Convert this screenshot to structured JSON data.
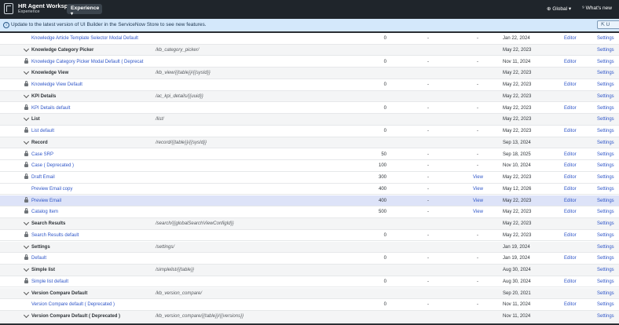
{
  "header": {
    "app_title": "HR Agent Workspace",
    "app_subtitle": "Experience",
    "experience_btn": "Experience",
    "global_label": "Global",
    "whats_new": "What's new"
  },
  "banner": {
    "message": "Update to the latest version of UI Builder in the ServiceNow Store to see new features.",
    "button": "U"
  },
  "rows": [
    {
      "type": "item",
      "locked": false,
      "name": "Knowledge Article Template Selector Modal Default",
      "path": "",
      "order": "0",
      "d1": "-",
      "d2": "-",
      "date": "Jan 22, 2024",
      "editor": "Editor",
      "settings": "Settings"
    },
    {
      "type": "group",
      "name": "Knowledge Category Picker",
      "path": "/kb_category_picker/",
      "order": "",
      "d1": "",
      "d2": "",
      "date": "May 22, 2023",
      "editor": "",
      "settings": "Settings"
    },
    {
      "type": "item",
      "locked": true,
      "name": "Knowledge Category Picker Modal Default ( Deprecat",
      "path": "",
      "order": "0",
      "d1": "-",
      "d2": "-",
      "date": "Nov 11, 2024",
      "editor": "Editor",
      "settings": "Settings"
    },
    {
      "type": "group",
      "name": "Knowledge View",
      "path": "/kb_view/{{table}}/{{sysId}}",
      "order": "",
      "d1": "",
      "d2": "",
      "date": "May 22, 2023",
      "editor": "",
      "settings": "Settings"
    },
    {
      "type": "item",
      "locked": true,
      "name": "Knowledge View Default",
      "path": "",
      "order": "0",
      "d1": "-",
      "d2": "-",
      "date": "May 22, 2023",
      "editor": "Editor",
      "settings": "Settings"
    },
    {
      "type": "group",
      "name": "KPI Details",
      "path": "/ac_kpi_details/{{uuid}}",
      "order": "",
      "d1": "",
      "d2": "",
      "date": "May 22, 2023",
      "editor": "",
      "settings": "Settings"
    },
    {
      "type": "item",
      "locked": true,
      "name": "KPI Details default",
      "path": "",
      "order": "0",
      "d1": "-",
      "d2": "-",
      "date": "May 22, 2023",
      "editor": "Editor",
      "settings": "Settings"
    },
    {
      "type": "group",
      "name": "List",
      "path": "/list/",
      "order": "",
      "d1": "",
      "d2": "",
      "date": "May 22, 2023",
      "editor": "",
      "settings": "Settings"
    },
    {
      "type": "item",
      "locked": true,
      "name": "List default",
      "path": "",
      "order": "0",
      "d1": "-",
      "d2": "-",
      "date": "May 22, 2023",
      "editor": "Editor",
      "settings": "Settings"
    },
    {
      "type": "group",
      "name": "Record",
      "path": "/record/{{table}}/{{sysId}}",
      "order": "",
      "d1": "",
      "d2": "",
      "date": "Sep 13, 2024",
      "editor": "",
      "settings": "Settings"
    },
    {
      "type": "item",
      "locked": true,
      "name": "Case SRP",
      "path": "",
      "order": "50",
      "d1": "-",
      "d2": "-",
      "date": "Sep 18, 2025",
      "editor": "Editor",
      "settings": "Settings"
    },
    {
      "type": "item",
      "locked": true,
      "name": "Case ( Deprecated )",
      "path": "",
      "order": "100",
      "d1": "-",
      "d2": "-",
      "date": "Nov 10, 2024",
      "editor": "Editor",
      "settings": "Settings"
    },
    {
      "type": "item",
      "locked": true,
      "name": "Draft Email",
      "path": "",
      "order": "300",
      "d1": "-",
      "d2": "View",
      "date": "May 22, 2023",
      "editor": "Editor",
      "settings": "Settings"
    },
    {
      "type": "item",
      "locked": false,
      "name": "Preview Email copy",
      "path": "",
      "order": "400",
      "d1": "-",
      "d2": "View",
      "date": "May 12, 2026",
      "editor": "Editor",
      "settings": "Settings"
    },
    {
      "type": "item",
      "locked": true,
      "highlight": true,
      "name": "Preview Email",
      "path": "",
      "order": "400",
      "d1": "-",
      "d2": "View",
      "date": "May 22, 2023",
      "editor": "Editor",
      "settings": "Settings"
    },
    {
      "type": "item",
      "locked": true,
      "name": "Catalog Item",
      "path": "",
      "order": "500",
      "d1": "-",
      "d2": "View",
      "date": "May 22, 2023",
      "editor": "Editor",
      "settings": "Settings"
    },
    {
      "type": "group",
      "name": "Search Results",
      "path": "/search/{{globalSearchViewConfigId}}",
      "order": "",
      "d1": "",
      "d2": "",
      "date": "May 22, 2023",
      "editor": "",
      "settings": "Settings"
    },
    {
      "type": "item",
      "locked": true,
      "name": "Search Results default",
      "path": "",
      "order": "0",
      "d1": "-",
      "d2": "-",
      "date": "May 22, 2023",
      "editor": "Editor",
      "settings": "Settings"
    },
    {
      "type": "group",
      "name": "Settings",
      "path": "/settings/",
      "order": "",
      "d1": "",
      "d2": "",
      "date": "Jan 19, 2024",
      "editor": "",
      "settings": "Settings"
    },
    {
      "type": "item",
      "locked": true,
      "name": "Default",
      "path": "",
      "order": "0",
      "d1": "-",
      "d2": "-",
      "date": "Jan 19, 2024",
      "editor": "Editor",
      "settings": "Settings"
    },
    {
      "type": "group",
      "name": "Simple list",
      "path": "/simplelist/{{table}}",
      "order": "",
      "d1": "",
      "d2": "",
      "date": "Aug 30, 2024",
      "editor": "",
      "settings": "Settings"
    },
    {
      "type": "item",
      "locked": true,
      "name": "Simple list default",
      "path": "",
      "order": "0",
      "d1": "-",
      "d2": "-",
      "date": "Aug 30, 2024",
      "editor": "Editor",
      "settings": "Settings"
    },
    {
      "type": "group",
      "name": "Version Compare Default",
      "path": "/kb_version_compare/",
      "order": "",
      "d1": "",
      "d2": "",
      "date": "Sep 20, 2021",
      "editor": "",
      "settings": "Settings"
    },
    {
      "type": "item",
      "locked": false,
      "name": "Version Compare default ( Deprecated )",
      "path": "",
      "order": "0",
      "d1": "-",
      "d2": "-",
      "date": "Nov 11, 2024",
      "editor": "Editor",
      "settings": "Settings"
    },
    {
      "type": "group",
      "name": "Version Compare Default ( Deprecated )",
      "path": "/kb_version_compare/{{table}}/{{versions}}",
      "order": "",
      "d1": "",
      "d2": "",
      "date": "Nov 11, 2024",
      "editor": "",
      "settings": "Settings"
    }
  ]
}
